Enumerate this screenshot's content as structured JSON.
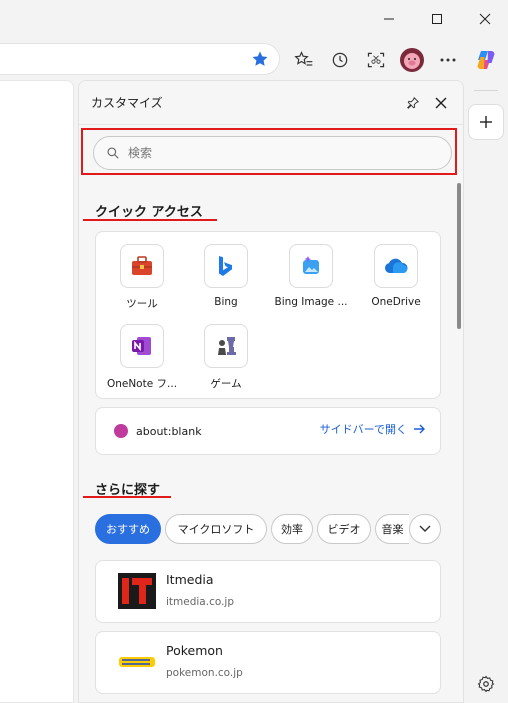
{
  "window": {
    "minimize": "—",
    "maximize": "☐",
    "close": "✕"
  },
  "toolbar": {
    "favorite_icon": "star-filled-icon",
    "favorites_icon": "favorites-list-icon",
    "history_icon": "history-icon",
    "screenshot_icon": "screenshot-icon",
    "profile_icon": "profile-avatar-icon",
    "more_icon": "more-icon",
    "copilot_icon": "copilot-icon"
  },
  "panel": {
    "title": "カスタマイズ",
    "search_placeholder": "検索",
    "quick_access_title": "クイック アクセス",
    "tiles": [
      {
        "label": "ツール",
        "icon": "toolbox-icon"
      },
      {
        "label": "Bing",
        "icon": "bing-icon"
      },
      {
        "label": "Bing Image ...",
        "icon": "bing-image-creator-icon"
      },
      {
        "label": "OneDrive",
        "icon": "onedrive-icon"
      },
      {
        "label": "OneNote フ...",
        "icon": "onenote-icon"
      },
      {
        "label": "ゲーム",
        "icon": "games-icon"
      }
    ],
    "blank": {
      "url": "about:blank",
      "action": "サイドバーで開く"
    },
    "explore_title": "さらに探す",
    "chips": [
      "おすすめ",
      "マイクロソフト",
      "効率",
      "ビデオ",
      "音楽"
    ],
    "sites": [
      {
        "name": "Itmedia",
        "url": "itmedia.co.jp",
        "logo_text": "IT"
      },
      {
        "name": "Pokemon",
        "url": "pokemon.co.jp",
        "logo_text": "Pokémon"
      }
    ]
  },
  "colors": {
    "accent": "#2a6fe0",
    "highlight": "#e01a1a",
    "link": "#1a5fd6"
  }
}
